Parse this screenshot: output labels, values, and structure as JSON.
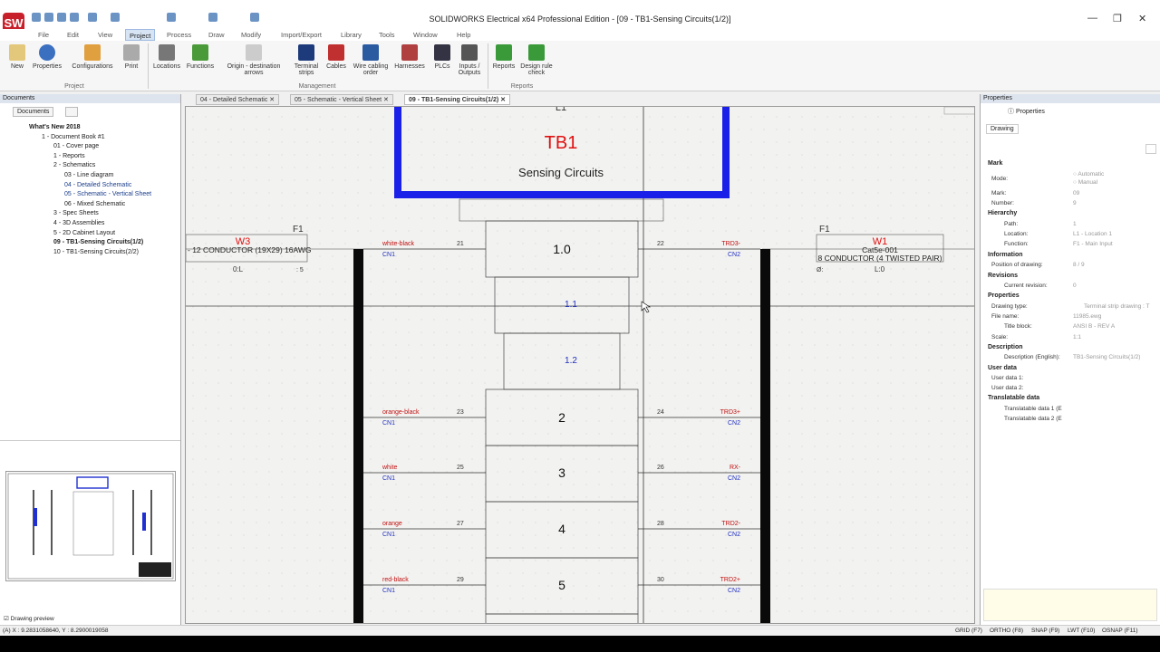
{
  "app": {
    "title": "SOLIDWORKS Electrical x64 Professional Edition - [09 - TB1-Sensing Circuits(1/2)]",
    "logo": "SW"
  },
  "menus": [
    "File",
    "Edit",
    "View",
    "Project",
    "Process",
    "Draw",
    "Modify",
    "Import/Export",
    "Library",
    "Tools",
    "Window",
    "Help"
  ],
  "active_menu": "Project",
  "ribbon": {
    "buttons": [
      "New",
      "Properties",
      "Configurations",
      "Print",
      "Locations",
      "Functions",
      "Origin - destination arrows",
      "Terminal strips",
      "Cables",
      "Wire cabling order",
      "Harnesses",
      "PLCs",
      "Inputs / Outputs",
      "Reports",
      "Design rule check"
    ],
    "groups": [
      "Project",
      "Management",
      "Reports"
    ]
  },
  "documents": {
    "title": "Documents",
    "tab": "Documents",
    "tree": [
      "What's New 2018",
      "1 - Document Book #1",
      "01 - Cover page",
      "1 - Reports",
      "2 - Schematics",
      "03 - Line diagram",
      "04 - Detailed Schematic",
      "05 - Schematic - Vertical Sheet",
      "06 - Mixed Schematic",
      "3 - Spec Sheets",
      "4 - 3D Assemblies",
      "5 - 2D Cabinet Layout",
      "09 - TB1-Sensing Circuits(1/2)",
      "10 - TB1-Sensing Circuits(2/2)"
    ],
    "preview_label": "Drawing preview"
  },
  "tabs": [
    "04 - Detailed Schematic",
    "05 - Schematic - Vertical Sheet",
    "09 - TB1-Sensing Circuits(1/2)"
  ],
  "schematic": {
    "top_label": "L1",
    "tb_name": "TB1",
    "tb_desc": "Sensing Circuits",
    "w3": {
      "name": "W3",
      "f": "F1",
      "desc": "- 12 CONDUCTOR (19X29) 16AWG",
      "pin": "0:L",
      "pin2": ": 5"
    },
    "w1": {
      "name": "W1",
      "f": "F1",
      "desc": "Cat5e-001",
      "desc2": "8 CONDUCTOR (4 TWISTED PAIR)",
      "pin": "L:0",
      "pin2": "Ø:"
    },
    "terminals": [
      "1.0",
      "1.1",
      "1.2",
      "2",
      "3",
      "4",
      "5"
    ],
    "left_wires": [
      {
        "label": "white-black",
        "cn": "CN1",
        "num": "21"
      },
      {
        "label": "orange-black",
        "cn": "CN1",
        "num": "23"
      },
      {
        "label": "white",
        "cn": "CN1",
        "num": "25"
      },
      {
        "label": "orange",
        "cn": "CN1",
        "num": "27"
      },
      {
        "label": "red-black",
        "cn": "CN1",
        "num": "29"
      }
    ],
    "right_wires": [
      {
        "label": "TRD3-",
        "cn": "CN2",
        "num": "22"
      },
      {
        "label": "TRD3+",
        "cn": "CN2",
        "num": "24"
      },
      {
        "label": "RX-",
        "cn": "CN2",
        "num": "26"
      },
      {
        "label": "TRD2-",
        "cn": "CN2",
        "num": "28"
      },
      {
        "label": "TRD2+",
        "cn": "CN2",
        "num": "30"
      }
    ]
  },
  "properties": {
    "title": "Properties",
    "tab": "Properties",
    "subtab": "Drawing",
    "sections": {
      "mark": "Mark",
      "hierarchy": "Hierarchy",
      "information": "Information",
      "revisions": "Revisions",
      "properties": "Properties",
      "description": "Description",
      "user_data": "User data",
      "translatable": "Translatable data"
    },
    "rows": {
      "mode": "Mode:",
      "mode_auto": "Automatic",
      "mode_manual": "Manual",
      "mark": "Mark:",
      "mark_v": "09",
      "number": "Number:",
      "number_v": "9",
      "path": "Path:",
      "path_v": "1",
      "location": "Location:",
      "location_v": "L1 - Location 1",
      "function": "Function:",
      "function_v": "F1 - Main Input",
      "position": "Position of drawing:",
      "position_v": "8 / 9",
      "cur_rev": "Current revision:",
      "cur_rev_v": "0",
      "drawing_type": "Drawing type:",
      "drawing_type_v": "Terminal strip drawing : T",
      "file_name": "File name:",
      "file_name_v": "11985.ewg",
      "title_block": "Title block:",
      "title_block_v": "ANSI B - REV A",
      "scale": "Scale:",
      "scale_v": "1:1",
      "desc_en": "Description (English):",
      "desc_en_v": "TB1-Sensing Circuits(1/2)",
      "ud1": "User data 1:",
      "ud2": "User data 2:",
      "td1": "Translatable data 1 (E",
      "td2": "Translatable data 2 (E"
    }
  },
  "status": {
    "coords": "(A) X : 9.2831058640, Y : 8.2900019058",
    "toggles": [
      "GRID (F7)",
      "ORTHO (F8)",
      "SNAP (F9)",
      "LWT (F10)",
      "OSNAP (F11)"
    ]
  }
}
